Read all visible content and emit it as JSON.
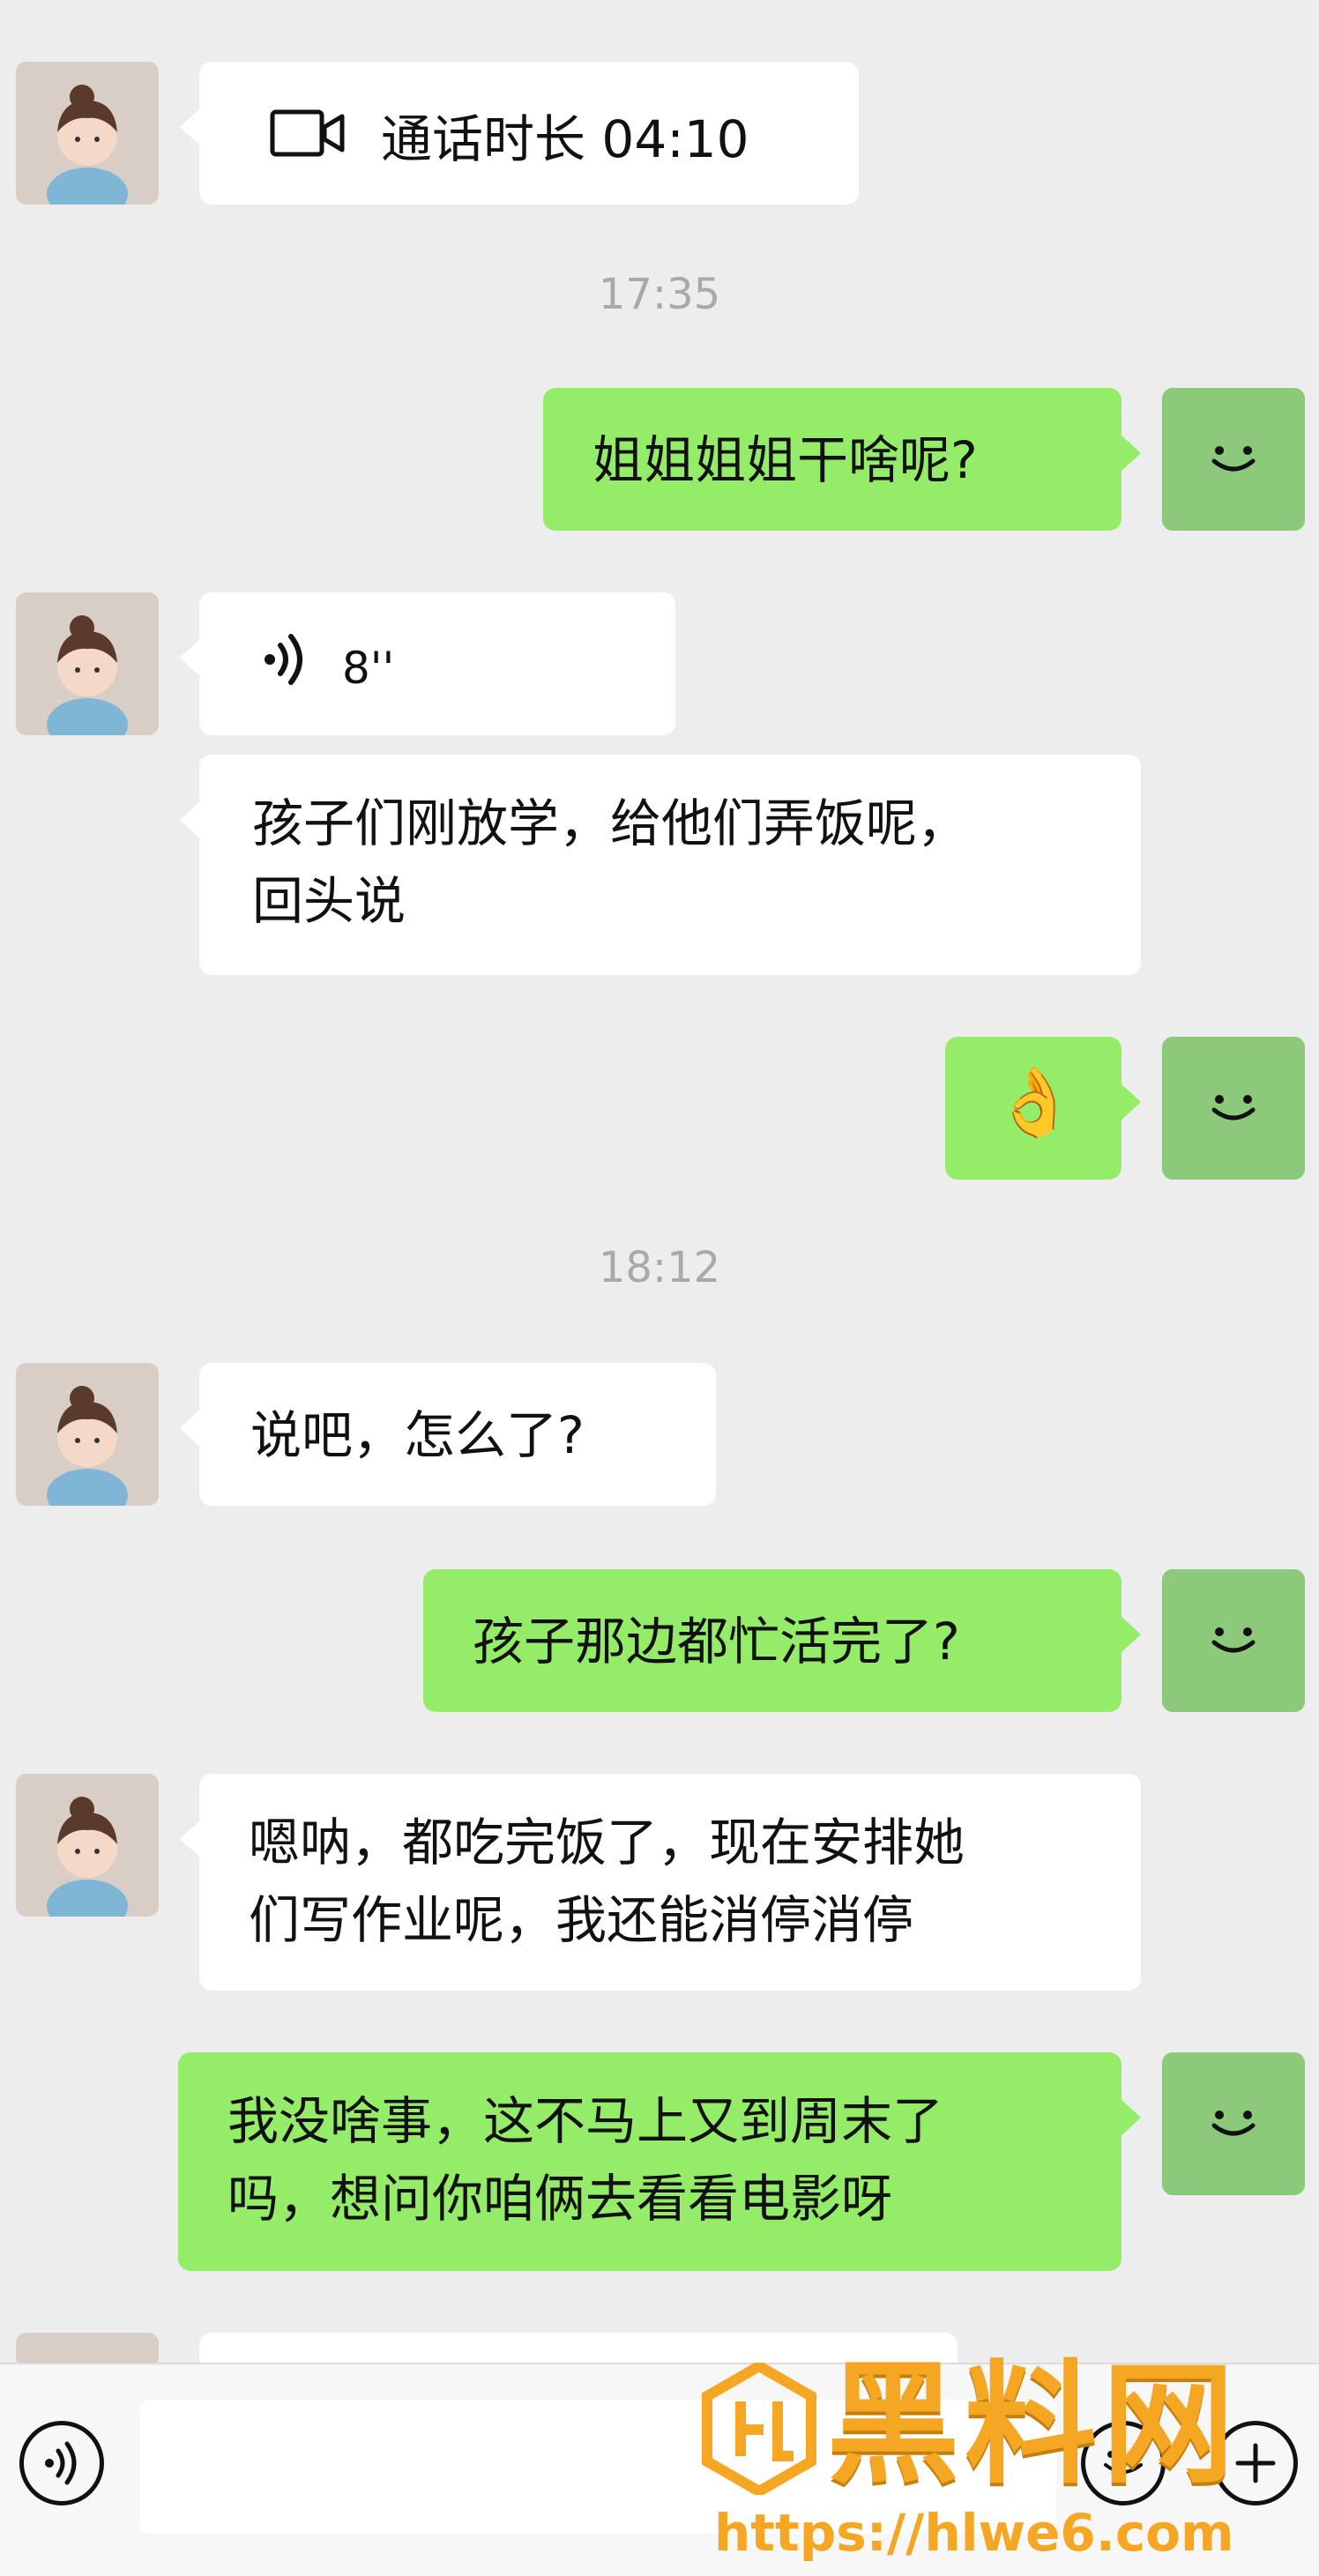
{
  "messages": {
    "call": {
      "label": "通话时长 04:10",
      "icon": "video-call-icon"
    },
    "time1": "17:35",
    "out1": "姐姐姐姐干啥呢?",
    "voice": {
      "duration": "8''",
      "icon": "voice-wave-icon"
    },
    "in2_line1": "孩子们刚放学，给他们弄饭呢，",
    "in2_line2": "回头说",
    "out2_emoji": "👌",
    "time2": "18:12",
    "in3": "说吧，怎么了?",
    "out3": "孩子那边都忙活完了?",
    "in4_line1": "嗯呐，都吃完饭了，现在安排她",
    "in4_line2": "们写作业呢，我还能消停消停",
    "out4_line1": "我没啥事，这不马上又到周末了",
    "out4_line2": "吗，想问你咱俩去看看电影呀"
  },
  "input_bar": {
    "voice_icon": "voice-toggle-icon",
    "emoji_icon": "emoji-icon",
    "plus_icon": "plus-icon"
  },
  "watermark": {
    "title": "黑料网",
    "url": "https://hlwe6.com"
  },
  "colors": {
    "background": "#ededed",
    "incoming": "#ffffff",
    "outgoing": "#95ec69",
    "watermark": "#f5a623"
  }
}
